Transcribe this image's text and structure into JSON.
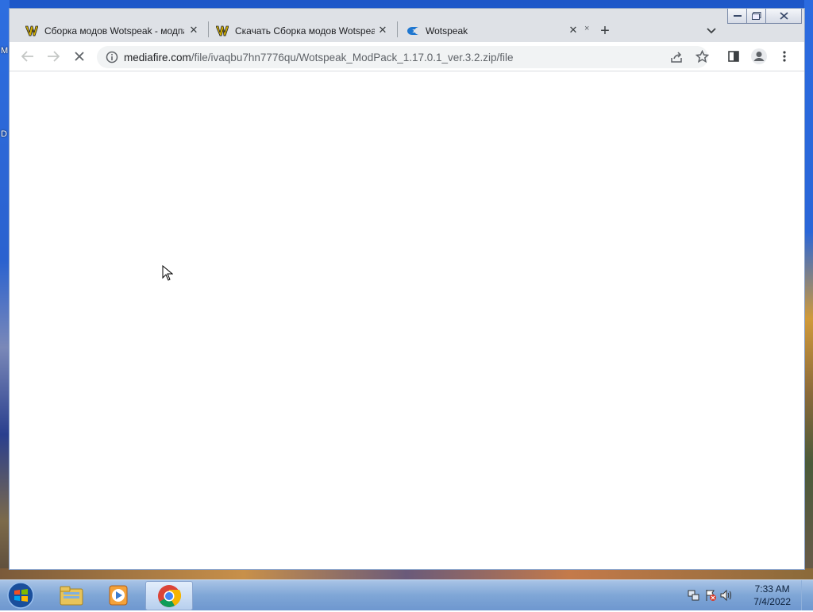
{
  "desktop": {
    "icon_letter_1": "M",
    "icon_letter_2": "D"
  },
  "browser": {
    "tabs": [
      {
        "title": "Сборка модов Wotspeak - модпак",
        "icon": "wotspeak-w-icon",
        "active": false
      },
      {
        "title": "Скачать Сборка модов Wotspeak",
        "icon": "wotspeak-w-icon",
        "active": false
      },
      {
        "title": "Wotspeak",
        "icon": "mediafire-icon",
        "active": true
      }
    ],
    "new_tab": "+",
    "address": {
      "host": "mediafire.com",
      "path": "/file/ivaqbu7hn7776qu/Wotspeak_ModPack_1.17.0.1_ver.3.2.zip/file"
    },
    "loading": true
  },
  "taskbar": {
    "apps": [
      "windows-explorer-icon",
      "media-player-icon",
      "chrome-icon"
    ],
    "clock": {
      "time": "7:33 AM",
      "date": "7/4/2022"
    }
  },
  "colors": {
    "tabstrip": "#dee1e6",
    "omnibox": "#f1f3f4",
    "taskbar": "#7fa6d6"
  }
}
